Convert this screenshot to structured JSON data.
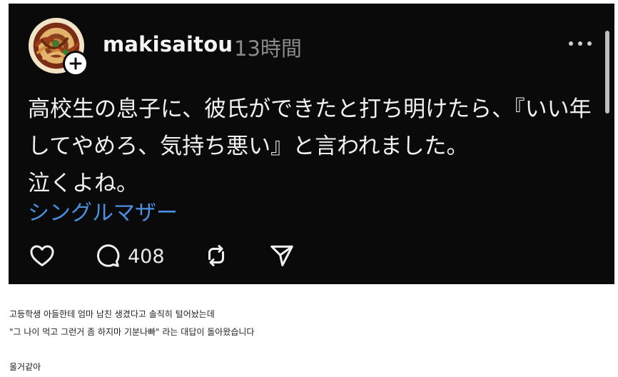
{
  "post": {
    "username": "makisaitou",
    "timestamp": "13時間",
    "lines": [
      "高校生の息子に、彼氏ができたと打ち明けたら、『いい年",
      "してやめろ、気持ち悪い』と言われました。",
      "泣くよね。"
    ],
    "topic_tag": "シングルマザー",
    "reply_count": "408"
  },
  "caption": {
    "line1": "고등학생 아들한테 엄마 남친 생겼다고 솔직히 털어놨는데",
    "line2": "\"그 나이 먹고 그런거 좀 하지마 기분나빠\" 라는 대답이 돌아왔습니다",
    "line3": "울거같아"
  },
  "icons": {
    "like": "heart-icon",
    "reply": "comment-icon",
    "repost": "repost-icon",
    "share": "send-icon",
    "more": "more-dots-icon",
    "follow": "plus-icon"
  },
  "colors": {
    "post_background": "#0a0a0a",
    "tag_link": "#4a8fe0",
    "timestamp": "#8a8a8a"
  }
}
